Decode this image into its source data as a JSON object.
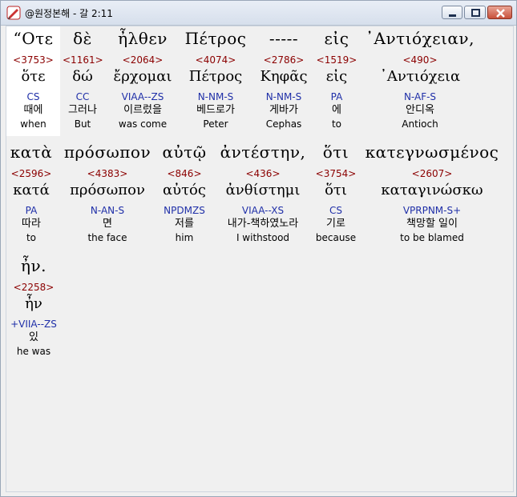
{
  "window": {
    "title": "@원정본해 - 갈 2:11",
    "minimize_icon": "minimize-icon",
    "maximize_icon": "maximize-icon",
    "close_icon": "close-icon"
  },
  "words": [
    {
      "greek": "“Οτε",
      "strong": "<3753>",
      "lemma": "ὅτε",
      "parse": "CS",
      "korean": "때에",
      "english": "when"
    },
    {
      "greek": "δὲ",
      "strong": "<1161>",
      "lemma": "δώ",
      "parse": "CC",
      "korean": "그러나",
      "english": "But"
    },
    {
      "greek": "ἦλθεν",
      "strong": "<2064>",
      "lemma": "ἔρχομαι",
      "parse": "VIAA--ZS",
      "korean": "이르렀을",
      "english": "was come"
    },
    {
      "greek": "Πέτρος",
      "strong": "<4074>",
      "lemma": "Πέτρος",
      "parse": "N-NM-S",
      "korean": "베드로가",
      "english": "Peter"
    },
    {
      "greek": "-----",
      "strong": "<2786>",
      "lemma": "Κηφᾶς",
      "parse": "N-NM-S",
      "korean": "게바가",
      "english": "Cephas"
    },
    {
      "greek": "εἰς",
      "strong": "<1519>",
      "lemma": "εἰς",
      "parse": "PA",
      "korean": "에",
      "english": "to"
    },
    {
      "greek": "᾿Αντιόχειαν,",
      "strong": "<490>",
      "lemma": "᾿Αντιόχεια",
      "parse": "N-AF-S",
      "korean": "안디옥",
      "english": "Antioch"
    },
    {
      "greek": "κατὰ",
      "strong": "<2596>",
      "lemma": "κατά",
      "parse": "PA",
      "korean": "따라",
      "english": "to"
    },
    {
      "greek": "πρόσωπον",
      "strong": "<4383>",
      "lemma": "πρόσωπον",
      "parse": "N-AN-S",
      "korean": "면",
      "english": "the face"
    },
    {
      "greek": "αὐτῷ",
      "strong": "<846>",
      "lemma": "αὐτός",
      "parse": "NPDMZS",
      "korean": "저를",
      "english": "him"
    },
    {
      "greek": "ἀντέστην,",
      "strong": "<436>",
      "lemma": "ἀνθίστημι",
      "parse": "VIAA--XS",
      "korean": "내가-책하였노라",
      "english": "I withstood"
    },
    {
      "greek": "ὅτι",
      "strong": "<3754>",
      "lemma": "ὅτι",
      "parse": "CS",
      "korean": "기로",
      "english": "because"
    },
    {
      "greek": "κατεγνωσμένος",
      "strong": "<2607>",
      "lemma": "καταγινώσκω",
      "parse": "VPRPNM-S+",
      "korean": "책망할 일이",
      "english": "to be blamed"
    },
    {
      "greek": "ἦν.",
      "strong": "<2258>",
      "lemma": "ἦν",
      "parse": "+VIIA--ZS",
      "korean": "있",
      "english": "he was"
    }
  ]
}
